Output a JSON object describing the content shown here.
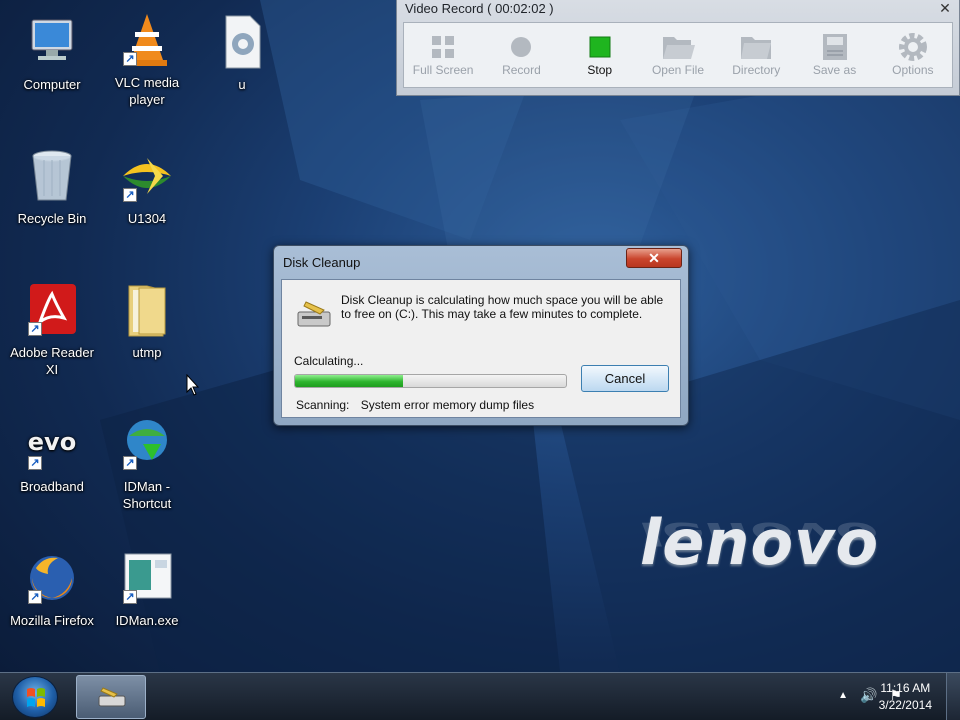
{
  "desktop": {
    "icons": [
      {
        "label": "Computer",
        "name": "computer-icon"
      },
      {
        "label": "VLC media player",
        "name": "vlc-icon"
      },
      {
        "label": "u",
        "name": "settings-file-icon"
      },
      {
        "label": "Recycle Bin",
        "name": "recycle-bin-icon"
      },
      {
        "label": "U1304",
        "name": "u1304-icon"
      },
      {
        "label": "Adobe Reader XI",
        "name": "adobe-reader-icon"
      },
      {
        "label": "utmp",
        "name": "folder-icon"
      },
      {
        "label": "Broadband",
        "name": "broadband-icon"
      },
      {
        "label": "IDMan - Shortcut",
        "name": "idman-shortcut-icon"
      },
      {
        "label": "Mozilla Firefox",
        "name": "firefox-icon"
      },
      {
        "label": "IDMan.exe",
        "name": "idman-exe-icon"
      }
    ]
  },
  "video_record": {
    "title": "Video Record  ( 00:02:02 )",
    "close_glyph": "✕",
    "buttons": [
      {
        "label": "Full Screen",
        "icon": "grid-icon",
        "active": false
      },
      {
        "label": "Record",
        "icon": "record-icon",
        "active": false
      },
      {
        "label": "Stop",
        "icon": "stop-icon",
        "active": true
      },
      {
        "label": "Open File",
        "icon": "open-folder-icon",
        "active": false
      },
      {
        "label": "Directory",
        "icon": "folder-icon",
        "active": false
      },
      {
        "label": "Save as",
        "icon": "save-icon",
        "active": false
      },
      {
        "label": "Options",
        "icon": "gear-icon",
        "active": false
      }
    ]
  },
  "dialog": {
    "title": "Disk Cleanup",
    "close_glyph": "✕",
    "message": "Disk Cleanup is calculating how much space you will be able to free on  (C:). This may take a few minutes to complete.",
    "status": "Calculating...",
    "progress": 0.4,
    "cancel_label": "Cancel",
    "scan_label": "Scanning:",
    "scan_item": "System error memory dump files"
  },
  "brand": {
    "text": "lenovo"
  },
  "taskbar": {
    "time": "11:16 AM",
    "date": "3/22/2014",
    "tray_up_glyph": "▲",
    "volume_glyph": "🔊",
    "flag_glyph": "⚑"
  },
  "colors": {
    "accent_green": "#1fb51f",
    "close_red": "#c9452d",
    "desktop_blue": "#1b3f73"
  }
}
